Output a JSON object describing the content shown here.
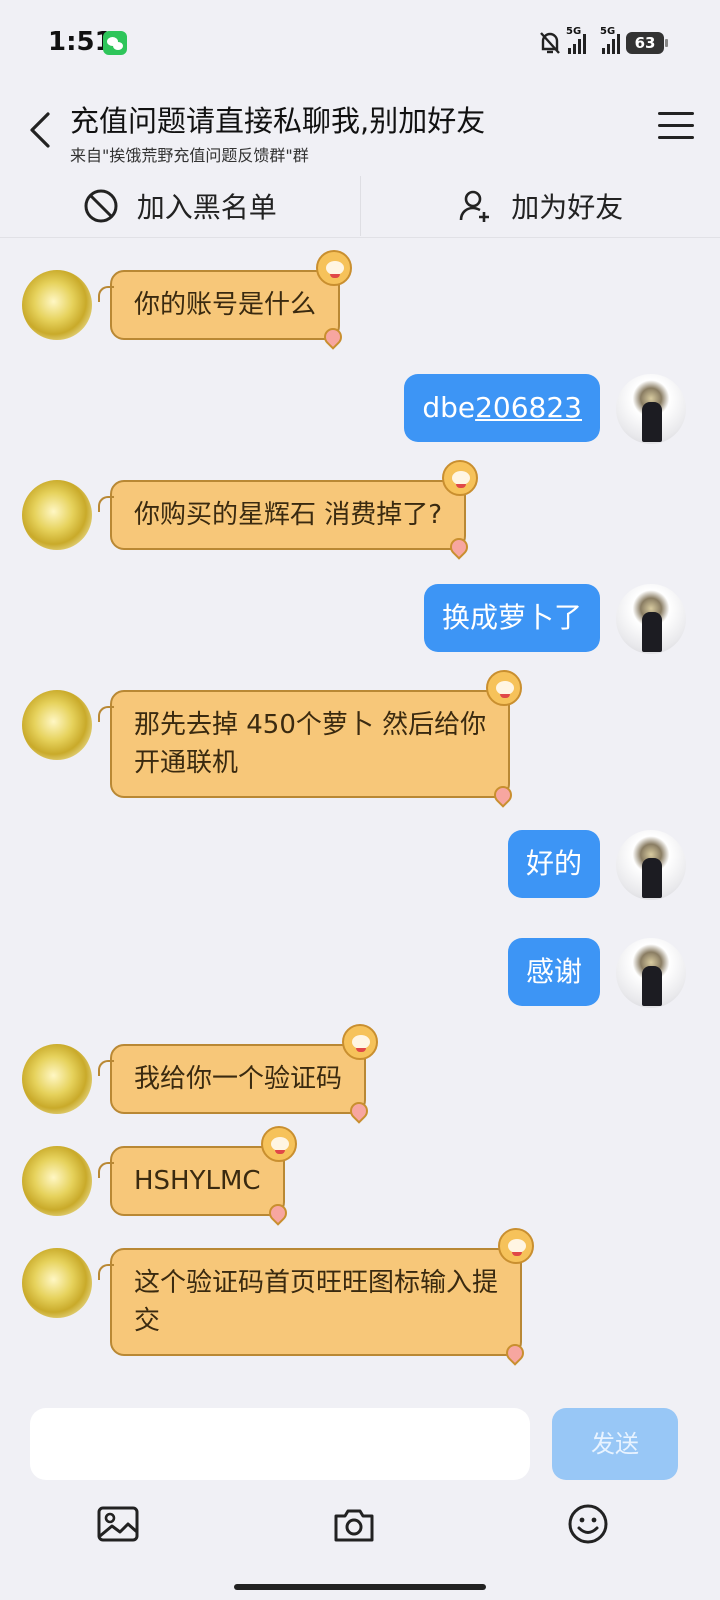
{
  "status": {
    "time": "1:51",
    "battery": "63",
    "sim1": "5G",
    "sim2": "5G"
  },
  "header": {
    "title": "充值问题请直接私聊我,别加好友",
    "subtitle": "来自\"挨饿荒野充值问题反馈群\"群"
  },
  "actions": {
    "block": "加入黑名单",
    "add_friend": "加为好友"
  },
  "messages": [
    {
      "side": "left",
      "text": "你的账号是什么"
    },
    {
      "side": "right",
      "text_prefix": "dbe",
      "text_link": "206823"
    },
    {
      "side": "left",
      "text": "你购买的星辉石 消费掉了?"
    },
    {
      "side": "right",
      "text": "换成萝卜了"
    },
    {
      "side": "left",
      "line1": "那先去掉  450个萝卜 然后给你",
      "line2": "开通联机"
    },
    {
      "side": "right",
      "text": "好的"
    },
    {
      "side": "right",
      "text": "感谢"
    },
    {
      "side": "left",
      "text": "我给你一个验证码"
    },
    {
      "side": "left",
      "text": "HSHYLMC"
    },
    {
      "side": "left",
      "line1": "这个验证码首页旺旺图标输入提",
      "line2": "交"
    }
  ],
  "composer": {
    "input_value": "",
    "send_label": "发送"
  },
  "toolbar": {
    "icons": [
      "image-icon",
      "camera-icon",
      "emoji-icon"
    ]
  },
  "colors": {
    "left_bubble": "#f7c779",
    "right_bubble": "#3d95f5",
    "send_disabled": "#98c7f6",
    "background": "#f0f0f5"
  }
}
